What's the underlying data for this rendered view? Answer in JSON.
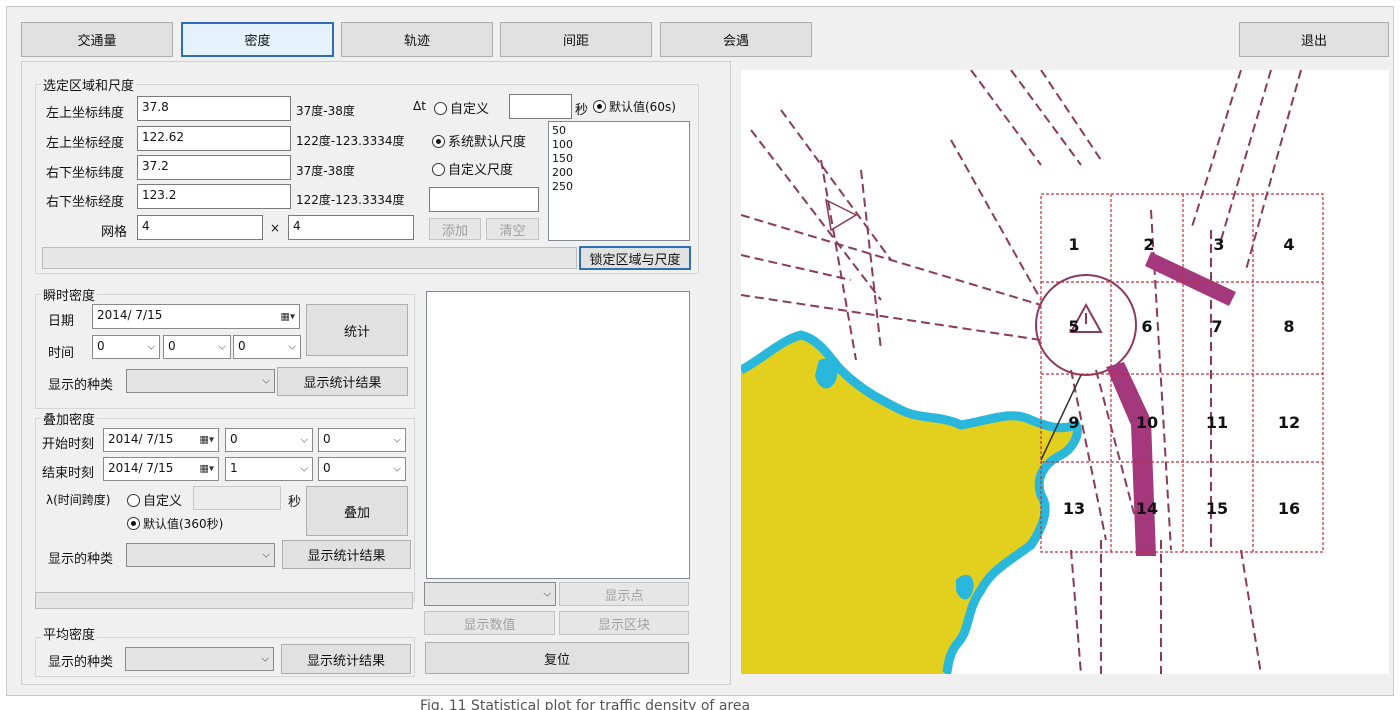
{
  "toolbar": {
    "tabs": [
      "交通量",
      "密度",
      "轨迹",
      "间距",
      "会遇"
    ],
    "exit_label": "退出"
  },
  "region": {
    "title": "选定区域和尺度",
    "tl_lat_label": "左上坐标纬度",
    "tl_lat_value": "37.8",
    "tl_lat_range": "37度-38度",
    "tl_lon_label": "左上坐标经度",
    "tl_lon_value": "122.62",
    "tl_lon_range": "122度-123.3334度",
    "br_lat_label": "右下坐标纬度",
    "br_lat_value": "37.2",
    "br_lat_range": "37度-38度",
    "br_lon_label": "右下坐标经度",
    "br_lon_value": "123.2",
    "br_lon_range": "122度-123.3334度",
    "grid_label": "网格",
    "grid_x": "4",
    "times": "×",
    "grid_y": "4",
    "dt_label": "Δt",
    "custom_label": "自定义",
    "sec_label": "秒",
    "default_label": "默认值(60s)",
    "sys_scale_label": "系统默认尺度",
    "custom_scale_label": "自定义尺度",
    "scales": [
      "50",
      "100",
      "150",
      "200",
      "250"
    ],
    "add_label": "添加",
    "clear_label": "清空",
    "lock_label": "锁定区域与尺度"
  },
  "instant": {
    "title": "瞬时密度",
    "date_label": "日期",
    "date_value": "2014/  7/15",
    "time_label": "时间",
    "hour": "0",
    "minute": "0",
    "second": "0",
    "stat_label": "统计",
    "kind_label": "显示的种类",
    "show_label": "显示统计结果"
  },
  "overlay": {
    "title": "叠加密度",
    "start_label": "开始时刻",
    "start_date": "2014/  7/15",
    "start_a": "0",
    "start_b": "0",
    "end_label": "结束时刻",
    "end_date": "2014/  7/15",
    "end_a": "1",
    "end_b": "0",
    "lambda_label": "λ(时间跨度)",
    "custom_label": "自定义",
    "sec_label": "秒",
    "default_label": "默认值(360秒)",
    "overlay_label": "叠加",
    "kind_label": "显示的种类",
    "show_label": "显示统计结果"
  },
  "average": {
    "title": "平均密度",
    "kind_label": "显示的种类",
    "show_label": "显示统计结果"
  },
  "result": {
    "show_points": "显示点",
    "show_values": "显示数值",
    "show_blocks": "显示区块",
    "reset": "复位"
  },
  "map": {
    "cells": [
      "1",
      "2",
      "3",
      "4",
      "5",
      "6",
      "7",
      "8",
      "9",
      "10",
      "11",
      "12",
      "13",
      "14",
      "15",
      "16"
    ],
    "colors": {
      "land": "#e2cf1e",
      "shore": "#29b8dc",
      "lane": "#8a3a5c",
      "highlight": "#a3387c",
      "grid": "#c0303a"
    }
  },
  "caption": "Fig. 11  Statistical plot for traffic density of area"
}
